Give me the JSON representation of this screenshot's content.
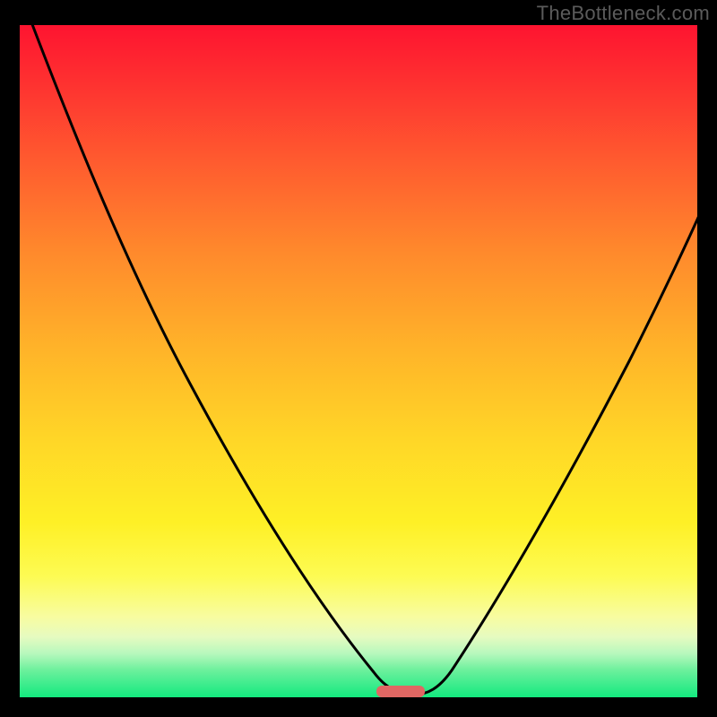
{
  "watermark": "TheBottleneck.com",
  "chart_data": {
    "type": "line",
    "title": "",
    "xlabel": "",
    "ylabel": "",
    "xlim": [
      0,
      100
    ],
    "ylim": [
      0,
      100
    ],
    "background_gradient": {
      "top_color": "#fe1430",
      "bottom_color": "#13e97f",
      "direction": "vertical",
      "meaning": "red=high bottleneck, green=low bottleneck"
    },
    "series": [
      {
        "name": "bottleneck-curve",
        "x": [
          0,
          5,
          10,
          15,
          20,
          25,
          30,
          35,
          40,
          45,
          50,
          53,
          56,
          58,
          60,
          65,
          70,
          75,
          80,
          85,
          90,
          95,
          100
        ],
        "y": [
          100,
          90,
          80,
          71,
          62,
          53,
          45,
          37,
          29,
          22,
          14,
          8,
          3,
          1,
          1,
          7,
          15,
          24,
          34,
          45,
          57,
          69,
          79
        ]
      }
    ],
    "marker": {
      "x_center": 58,
      "y": 0.5,
      "width": 7,
      "color": "#e06763",
      "shape": "rounded-bar"
    },
    "grid": false,
    "legend": false
  }
}
